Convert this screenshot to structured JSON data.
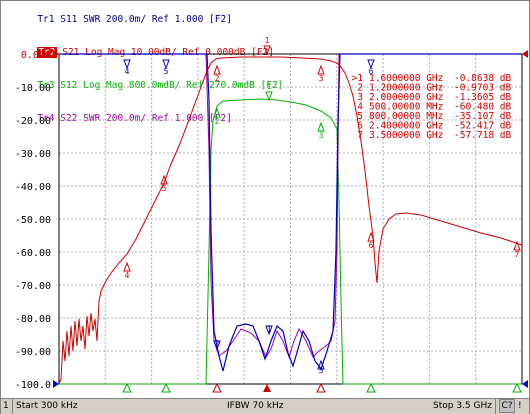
{
  "traces": [
    {
      "id": "Tr1",
      "label": "Tr1",
      "param": "S11",
      "fmt": "SWR",
      "scale": "200.0m/",
      "ref": "Ref 1.000",
      "ch": "[F2]",
      "color": "#00008b",
      "active": false
    },
    {
      "id": "Tr2",
      "label": "Tr2",
      "param": "S21",
      "fmt": "Log Mag",
      "scale": "10.00dB/",
      "ref": "Ref 0.000dB",
      "ch": "[F2]",
      "color": "#d00000",
      "active": true
    },
    {
      "id": "Tr3",
      "label": "Tr3",
      "param": "S12",
      "fmt": "Log Mag",
      "scale": "800.0mdB/",
      "ref": "Ref 270.0mdB",
      "ch": "[F2]",
      "color": "#00b000",
      "active": false
    },
    {
      "id": "Tr4",
      "label": "Tr4",
      "param": "S22",
      "fmt": "SWR",
      "scale": "200.0m/",
      "ref": "Ref 1.000",
      "ch": "[F2]",
      "color": "#a000a0",
      "active": false
    }
  ],
  "y_axis": {
    "labels": [
      "0.000",
      "-10.00",
      "-20.00",
      "-30.00",
      "-40.00",
      "-50.00",
      "-60.00",
      "-70.00",
      "-80.00",
      "-90.00",
      "-100.0"
    ],
    "label_color": "#d00000"
  },
  "markers_table": [
    {
      "num": ">1",
      "freq": "1.6000000 GHz",
      "value": "-0.8638 dB"
    },
    {
      "num": "2",
      "freq": "1.2000000 GHz",
      "value": "-0.9703 dB"
    },
    {
      "num": "3",
      "freq": "2.0000000 GHz",
      "value": "-1.3605 dB"
    },
    {
      "num": "4",
      "freq": "500.00000 MHz",
      "value": "-60.480 dB"
    },
    {
      "num": "5",
      "freq": "800.00000 MHz",
      "value": "-35.107 dB"
    },
    {
      "num": "6",
      "freq": "2.4000000 GHz",
      "value": "-52.417 dB"
    },
    {
      "num": "7",
      "freq": "3.5000000 GHz",
      "value": "-57.718 dB"
    }
  ],
  "status": {
    "channel": "1",
    "start": "Start 300 kHz",
    "ifbw": "IFBW 70 kHz",
    "stop": "Stop 3.5 GHz",
    "cal": "C?",
    "flag": "!"
  },
  "colors": {
    "grid": "#b0b0b0",
    "s21": "#d00000",
    "s11": "#00008b",
    "s12": "#00b000",
    "s22": "#a000a0",
    "frame": "#000000"
  }
}
